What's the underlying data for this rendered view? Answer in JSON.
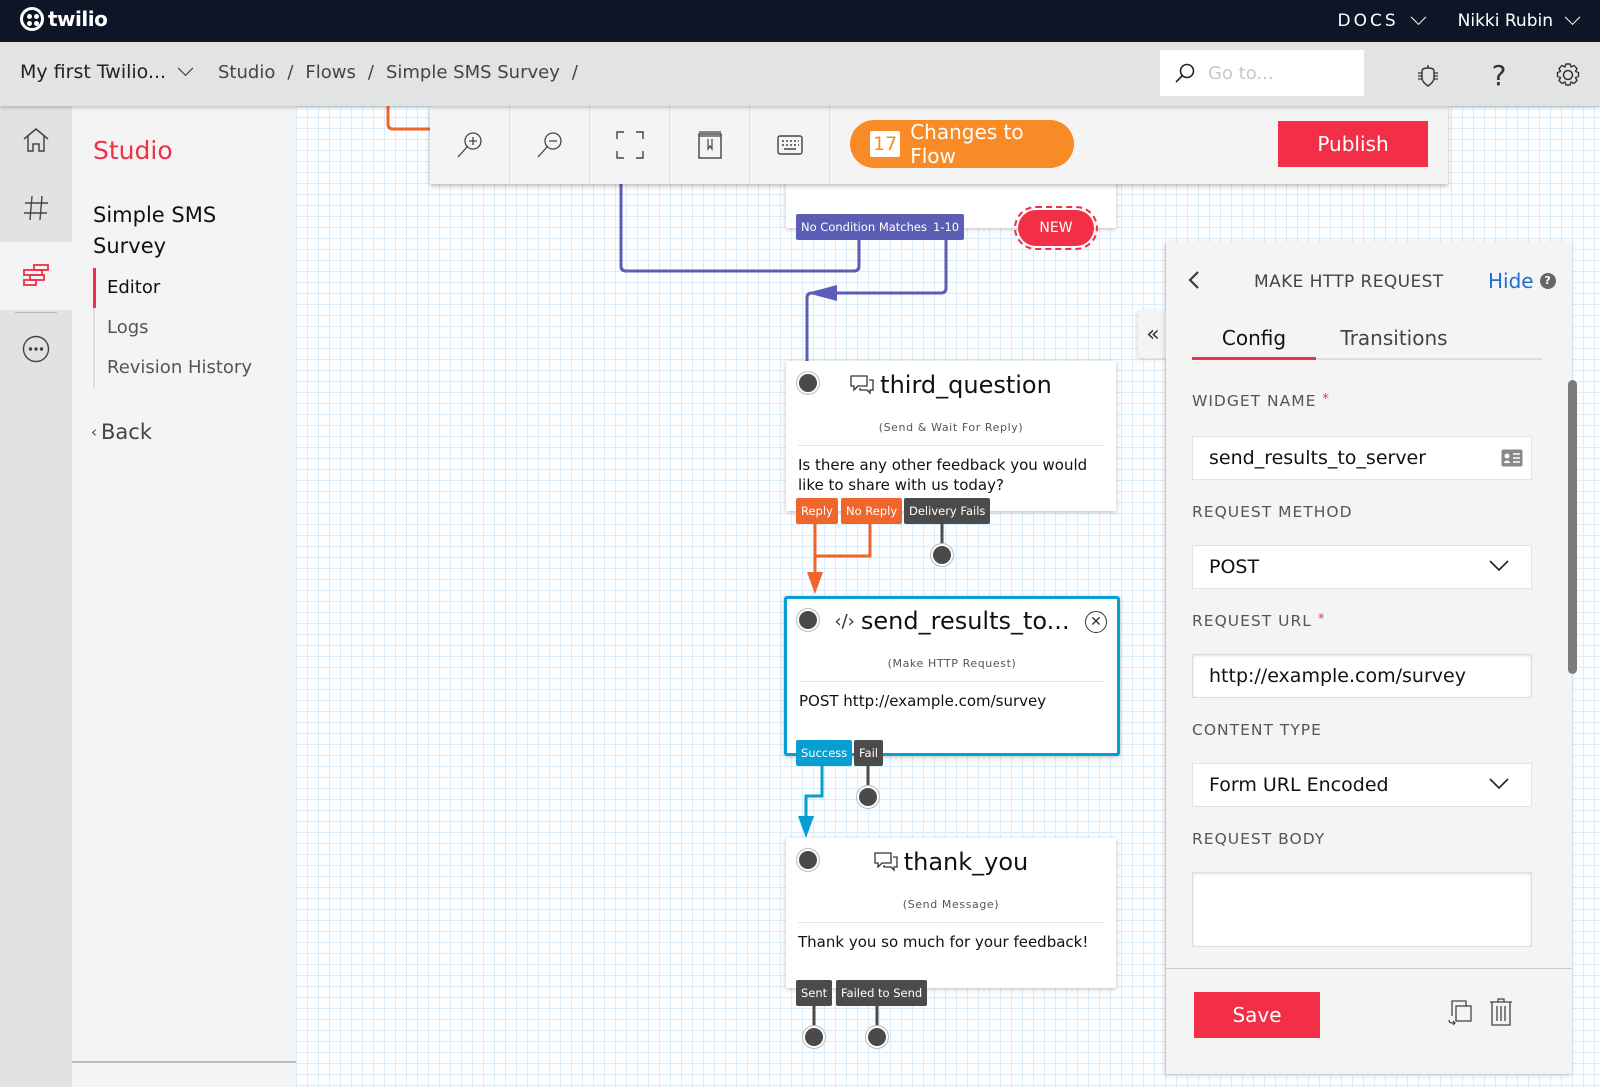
{
  "topbar": {
    "logo_text": "twilio",
    "docs_label": "DOCS",
    "user_name": "Nikki Rubin"
  },
  "subheader": {
    "account_label": "My first Twilio...",
    "breadcrumb": [
      "Studio",
      "/",
      "Flows",
      "/",
      "Simple SMS Survey",
      "/"
    ],
    "search_placeholder": "Go to...",
    "help_glyph": "?"
  },
  "rail": {
    "items": [
      {
        "icon": "home-icon"
      },
      {
        "icon": "hash-icon"
      },
      {
        "icon": "studio-icon",
        "active": true
      },
      {
        "icon": "more-icon"
      }
    ]
  },
  "sidebar": {
    "title": "Studio",
    "flow_name": "Simple SMS Survey",
    "nav": [
      {
        "label": "Editor",
        "active": true
      },
      {
        "label": "Logs"
      },
      {
        "label": "Revision History"
      }
    ],
    "back_label": "Back"
  },
  "toolbar": {
    "tools": [
      "zoom-in-icon",
      "zoom-out-icon",
      "fit-screen-icon",
      "bookmark-book-icon",
      "keyboard-icon"
    ],
    "changes_count": "17",
    "changes_label": "Changes to Flow",
    "publish_label": "Publish"
  },
  "canvas": {
    "new_badge": "NEW",
    "split_transitions": [
      "No Condition Matches",
      "1-10"
    ],
    "wire_colors": {
      "purple": "#5c5eb6",
      "orange": "#f0652c",
      "blue": "#079fd3",
      "dark": "#4b4b4b"
    },
    "widgets": [
      {
        "name": "third_question",
        "type": "(Send & Wait For Reply)",
        "body": "Is there any other feedback you would like to share with us today?",
        "transitions": [
          "Reply",
          "No Reply",
          "Delivery Fails"
        ]
      },
      {
        "name": "send_results_to...",
        "type": "(Make HTTP Request)",
        "body": "POST http://example.com/survey",
        "transitions": [
          "Success",
          "Fail"
        ],
        "selected": true
      },
      {
        "name": "thank_you",
        "type": "(Send Message)",
        "body": "Thank you so much for your feedback!",
        "transitions": [
          "Sent",
          "Failed to Send"
        ]
      }
    ]
  },
  "panel": {
    "title": "MAKE HTTP REQUEST",
    "hide_label": "Hide",
    "help_glyph": "?",
    "tabs": [
      {
        "label": "Config",
        "active": true
      },
      {
        "label": "Transitions"
      }
    ],
    "fields": {
      "widget_name": {
        "label": "WIDGET NAME",
        "required": "*",
        "value": "send_results_to_server"
      },
      "request_method": {
        "label": "REQUEST METHOD",
        "value": "POST"
      },
      "request_url": {
        "label": "REQUEST URL",
        "required": "*",
        "value": "http://example.com/survey"
      },
      "content_type": {
        "label": "CONTENT TYPE",
        "value": "Form URL Encoded"
      },
      "request_body": {
        "label": "REQUEST BODY",
        "value": ""
      }
    },
    "save_label": "Save"
  },
  "colors": {
    "brand_red": "#f22f46",
    "topbar_bg": "#0d1627",
    "changes_orange": "#f88b26",
    "link_blue": "#1f6fd1",
    "selected_border": "#079fd3"
  }
}
